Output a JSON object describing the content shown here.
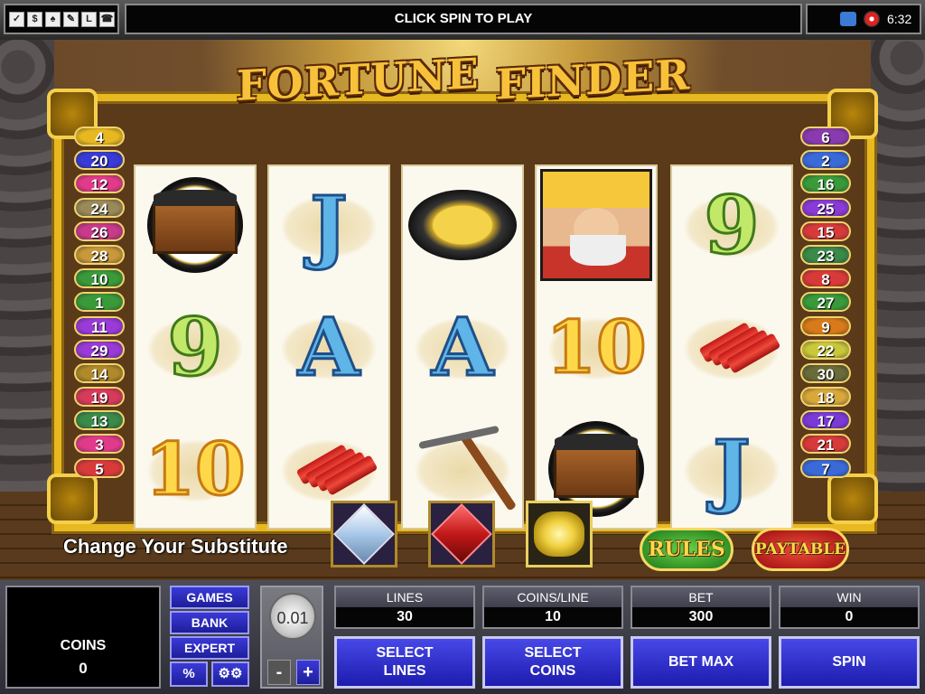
{
  "top_bar": {
    "message": "CLICK SPIN TO PLAY",
    "clock": "6:32",
    "icons": [
      "checkbox-icon",
      "dollar-icon",
      "cards-icon",
      "tools-icon",
      "l-icon",
      "phone-icon"
    ],
    "icon_glyphs": [
      "✓",
      "$",
      "♠",
      "✎",
      "L",
      "☎"
    ],
    "status_icons": [
      "network-icon",
      "sound-icon"
    ]
  },
  "game": {
    "logo_words": [
      "FORTUNE",
      "FINDER"
    ],
    "paylines_left": [
      "4",
      "20",
      "12",
      "24",
      "26",
      "28",
      "10",
      "1",
      "11",
      "29",
      "14",
      "19",
      "13",
      "3",
      "5"
    ],
    "paylines_right": [
      "6",
      "2",
      "16",
      "25",
      "15",
      "23",
      "8",
      "27",
      "9",
      "22",
      "30",
      "18",
      "17",
      "21",
      "7"
    ],
    "payline_colors_left": [
      "#e8b820",
      "#3a3ad8",
      "#e23a8a",
      "#9a8a5a",
      "#c83a8a",
      "#c8983a",
      "#3a9a3a",
      "#3a9a3a",
      "#9a3ad8",
      "#9a3ad8",
      "#b08a2a",
      "#d83a5a",
      "#3a8a4a",
      "#e23a8a",
      "#d83a3a"
    ],
    "payline_colors_right": [
      "#8a3ab0",
      "#3a6ad8",
      "#3a9a3a",
      "#8a3ad8",
      "#d83a3a",
      "#3a8a4a",
      "#d83a3a",
      "#3a9a3a",
      "#d87a1a",
      "#c8c83a",
      "#6a6a3a",
      "#d8a83a",
      "#7a3ad8",
      "#d83a3a",
      "#3a6ad8"
    ],
    "reels": [
      [
        "cart",
        "9",
        "10"
      ],
      [
        "J",
        "A",
        "dynamite"
      ],
      [
        "pan",
        "A",
        "pickaxe"
      ],
      [
        "miner",
        "10",
        "cart"
      ],
      [
        "9",
        "dynamite",
        "J"
      ]
    ],
    "substitute_label": "Change Your Substitute",
    "substitutes": [
      "diamond-icon",
      "ruby-icon",
      "gold-nugget-icon"
    ],
    "rules_label": "RULES",
    "paytable_label": "PAYTABLE"
  },
  "panel": {
    "coins_label": "COINS",
    "coins_value": "0",
    "games_label": "GAMES",
    "bank_label": "BANK",
    "expert_label": "EXPERT",
    "percent_label": "%",
    "settings_glyph": "⚙⚙",
    "denomination": "0.01",
    "minus_label": "-",
    "plus_label": "+",
    "stats": [
      {
        "label": "LINES",
        "value": "30"
      },
      {
        "label": "COINS/LINE",
        "value": "10"
      },
      {
        "label": "BET",
        "value": "300"
      },
      {
        "label": "WIN",
        "value": "0"
      }
    ],
    "actions": [
      "SELECT\nLINES",
      "SELECT\nCOINS",
      "BET MAX",
      "SPIN"
    ]
  }
}
